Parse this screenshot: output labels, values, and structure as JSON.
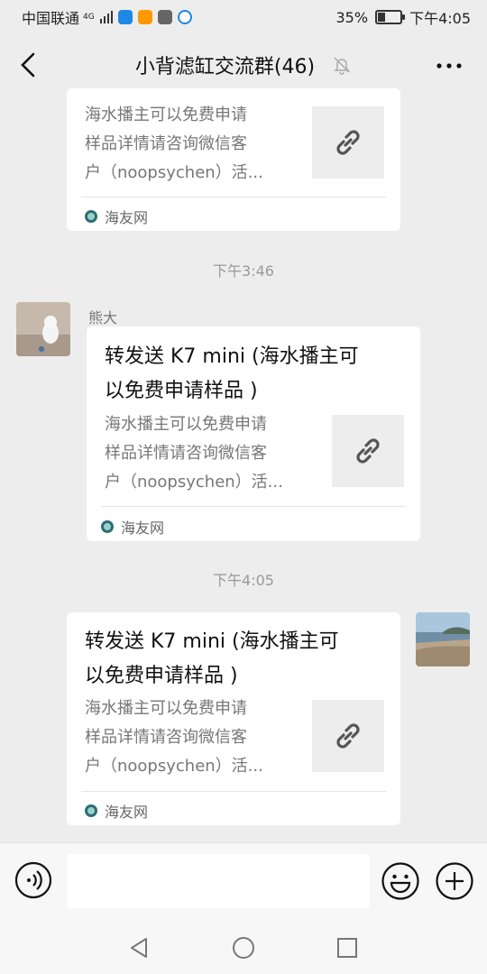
{
  "status_bar": {
    "carrier": "中国联通",
    "network": "4G",
    "battery": "35%",
    "battery_level": 0.35,
    "time": "下午4:05"
  },
  "header": {
    "title": "小背滤缸交流群(46)",
    "icons": {
      "back": "back-arrow-icon",
      "mute": "mute-bell-icon",
      "more": "more-icon"
    }
  },
  "messages": [
    {
      "type": "link-card",
      "side": "left",
      "description": "海水播主可以免费申请样品详情请咨询微信客户（noopsychen）活...",
      "description_lines": [
        "海水播主可以免费申请",
        "样品详情请咨询微信客",
        "户（noopsychen）活..."
      ],
      "source": "海友网"
    },
    {
      "type": "timestamp",
      "text": "下午3:46"
    },
    {
      "type": "link-card",
      "side": "left",
      "sender": "熊大",
      "title_lines": [
        "转发送 K7 mini (海水播主可",
        "以免费申请样品 )"
      ],
      "description_lines": [
        "海水播主可以免费申请",
        "样品详情请咨询微信客",
        "户（noopsychen）活..."
      ],
      "source": "海友网"
    },
    {
      "type": "timestamp",
      "text": "下午4:05"
    },
    {
      "type": "link-card",
      "side": "right",
      "title_lines": [
        "转发送 K7 mini (海水播主可",
        "以免费申请样品 )"
      ],
      "description_lines": [
        "海水播主可以免费申请",
        "样品详情请咨询微信客",
        "户（noopsychen）活..."
      ],
      "source": "海友网"
    }
  ],
  "input_bar": {
    "value": "",
    "icons": {
      "voice": "voice-icon",
      "emoji": "emoji-icon",
      "plus": "plus-icon"
    }
  },
  "colors": {
    "background": "#ededed",
    "card": "#ffffff",
    "text": "#111111",
    "muted": "#777777",
    "source_logo": "#2b6d78"
  }
}
